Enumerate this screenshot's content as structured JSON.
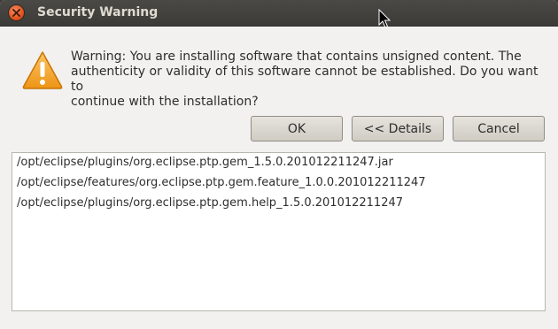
{
  "window": {
    "title": "Security Warning"
  },
  "dialog": {
    "message_lines": [
      "Warning: You are installing software that contains unsigned content. The",
      "authenticity or validity of this software cannot be established. Do you want to",
      "continue with the installation?"
    ],
    "buttons": {
      "ok": "OK",
      "details": "<< Details",
      "cancel": "Cancel"
    },
    "items": [
      "/opt/eclipse/plugins/org.eclipse.ptp.gem_1.5.0.201012211247.jar",
      "/opt/eclipse/features/org.eclipse.ptp.gem.feature_1.0.0.201012211247",
      "/opt/eclipse/plugins/org.eclipse.ptp.gem.help_1.5.0.201012211247"
    ]
  },
  "icons": {
    "close": "close-icon",
    "warning": "warning-icon",
    "cursor": "mouse-cursor-icon"
  },
  "colors": {
    "titlebar": "#3c3b37",
    "close_button": "#df4a15",
    "warning_icon": "#f2a82c"
  }
}
